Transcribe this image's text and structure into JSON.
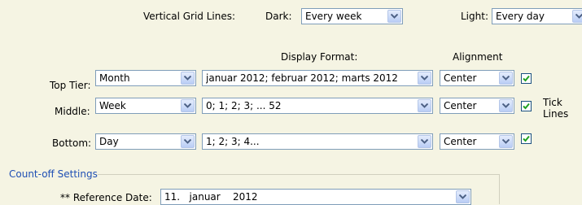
{
  "grid": {
    "title": "Vertical Grid Lines:",
    "dark_label": "Dark:",
    "dark_value": "Every week",
    "light_label": "Light:",
    "light_value": "Every day"
  },
  "headers": {
    "display_format": "Display Format:",
    "alignment": "Alignment"
  },
  "tiers": [
    {
      "label": "Top Tier:",
      "unit": "Month",
      "format": "januar 2012; februar 2012; marts 2012",
      "alignment": "Center",
      "tick": true
    },
    {
      "label": "Middle:",
      "unit": "Week",
      "format": "0; 1; 2; 3; ... 52",
      "alignment": "Center",
      "tick": true
    },
    {
      "label": "Bottom:",
      "unit": "Day",
      "format": "1; 2; 3; 4...",
      "alignment": "Center",
      "tick": true
    }
  ],
  "tick_lines_label_1": "Tick",
  "tick_lines_label_2": "Lines",
  "countoff": {
    "title": "Count-off Settings",
    "ref_label": "** Reference Date:",
    "ref_value": "11.   januar    2012"
  },
  "colors": {
    "background": "#f5f4e3",
    "group_title": "#1f4fb4",
    "check": "#21a121"
  }
}
